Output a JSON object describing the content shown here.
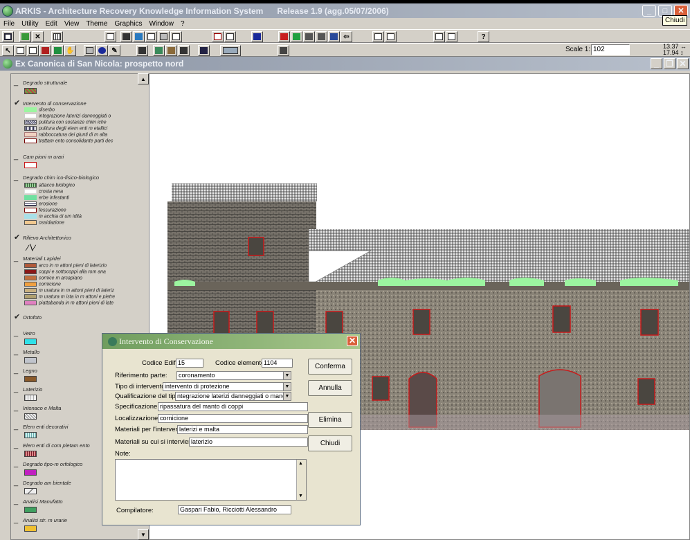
{
  "app": {
    "title": "ARKIS - Architecture Recovery Knowledge Information System",
    "release": "Release 1.9  (agg.05/07/2006)",
    "tooltip": "Chiudi",
    "menu": [
      "File",
      "Utility",
      "Edit",
      "View",
      "Theme",
      "Graphics",
      "Window",
      "?"
    ]
  },
  "toolbar": {
    "scale_label": "Scale 1:",
    "scale_value": "102",
    "coord_x": "13.37",
    "coord_y": "17.94"
  },
  "document": {
    "title": "Ex Canonica di San Nicola: prospetto nord"
  },
  "legend": {
    "layers": [
      {
        "name": "Degrado strutturale",
        "checked": false
      },
      {
        "name": "Intervento di conservazione",
        "checked": true,
        "items": [
          "diserbo",
          "integrazione laterizi danneggiati o",
          "pulitura con sostanze chim iche",
          "pulitura degli elem enti m etallici",
          "rabboccatura dei giunti di m alta",
          "trattam ento consolidante parti dec"
        ]
      },
      {
        "name": "Cam pioni m urari",
        "checked": false
      },
      {
        "name": "Degrado chim ico-fisico-biologico",
        "checked": false,
        "items": [
          "attacco biologico",
          "crosta nera",
          "erbe infestanti",
          "erosione",
          "fessurazione",
          "m acchia di um idità",
          "ossidazione"
        ]
      },
      {
        "name": "Rilievo Architettonico",
        "checked": true
      },
      {
        "name": "Materiali Lapidei",
        "checked": false,
        "items": [
          "arco in m attoni pieni di laterizio",
          "coppi e sottocoppi alla rom ana",
          "cornice m arcapiano",
          "cornicione",
          "m uratura in m attoni pieni di lateriz",
          "m uratura m ista in m attoni e pietre",
          "piattabanda in m attoni pieni di late"
        ]
      },
      {
        "name": "Ortofoto",
        "checked": true
      },
      {
        "name": "Vetro",
        "checked": false
      },
      {
        "name": "Metallo",
        "checked": false
      },
      {
        "name": "Legno",
        "checked": false
      },
      {
        "name": "Laterizio",
        "checked": false
      },
      {
        "name": "Intonaco e Malta",
        "checked": false
      },
      {
        "name": "Elem enti decorativi",
        "checked": false
      },
      {
        "name": "Elem enti di com pletam ento",
        "checked": false
      },
      {
        "name": "Degrado tipo-m orfologico",
        "checked": false
      },
      {
        "name": "Degrado am bientale",
        "checked": false
      },
      {
        "name": "Analisi Manufatto",
        "checked": false
      },
      {
        "name": "Analisi str. m urarie",
        "checked": false
      }
    ]
  },
  "dialog": {
    "title": "Intervento di Conservazione",
    "codice_edificio_label": "Codice Edificio:",
    "codice_edificio": "15",
    "codice_elemento_label": "Codice elemento:",
    "codice_elemento": "1104",
    "riferimento_label": "Riferimento parte:",
    "riferimento": "coronamento",
    "tipo_label": "Tipo di intervento:",
    "tipo": "intervento di protezione",
    "qualificazione_label": "Qualificazione del tipo:",
    "qualificazione": "ntegrazione laterizi danneggiati o mancanti",
    "specificazione_label": "Specificazione:",
    "specificazione": "ripassatura del manto di coppi",
    "localizzazione_label": "Localizzazione:",
    "localizzazione": "cornicione",
    "materiali_label": "Materiali per l'intervento:",
    "materiali": "laterizi e malta",
    "materiali_su_label": "Materiali su cui si interviene:",
    "materiali_su": "laterizio",
    "note_label": "Note:",
    "compilatore_label": "Compilatore:",
    "compilatore": "Gaspari Fabio, Ricciotti Alessandro",
    "buttons": {
      "conferma": "Conferma",
      "annulla": "Annulla",
      "elimina": "Elimina",
      "chiudi": "Chiudi"
    }
  },
  "colors": {
    "window_bg": "#d4d0c8",
    "title_grad": "#8a93a3",
    "dialog_title": "#6f9d5e",
    "red_outline": "#c81a1a",
    "diserbo_green": "#9cf5a0"
  }
}
